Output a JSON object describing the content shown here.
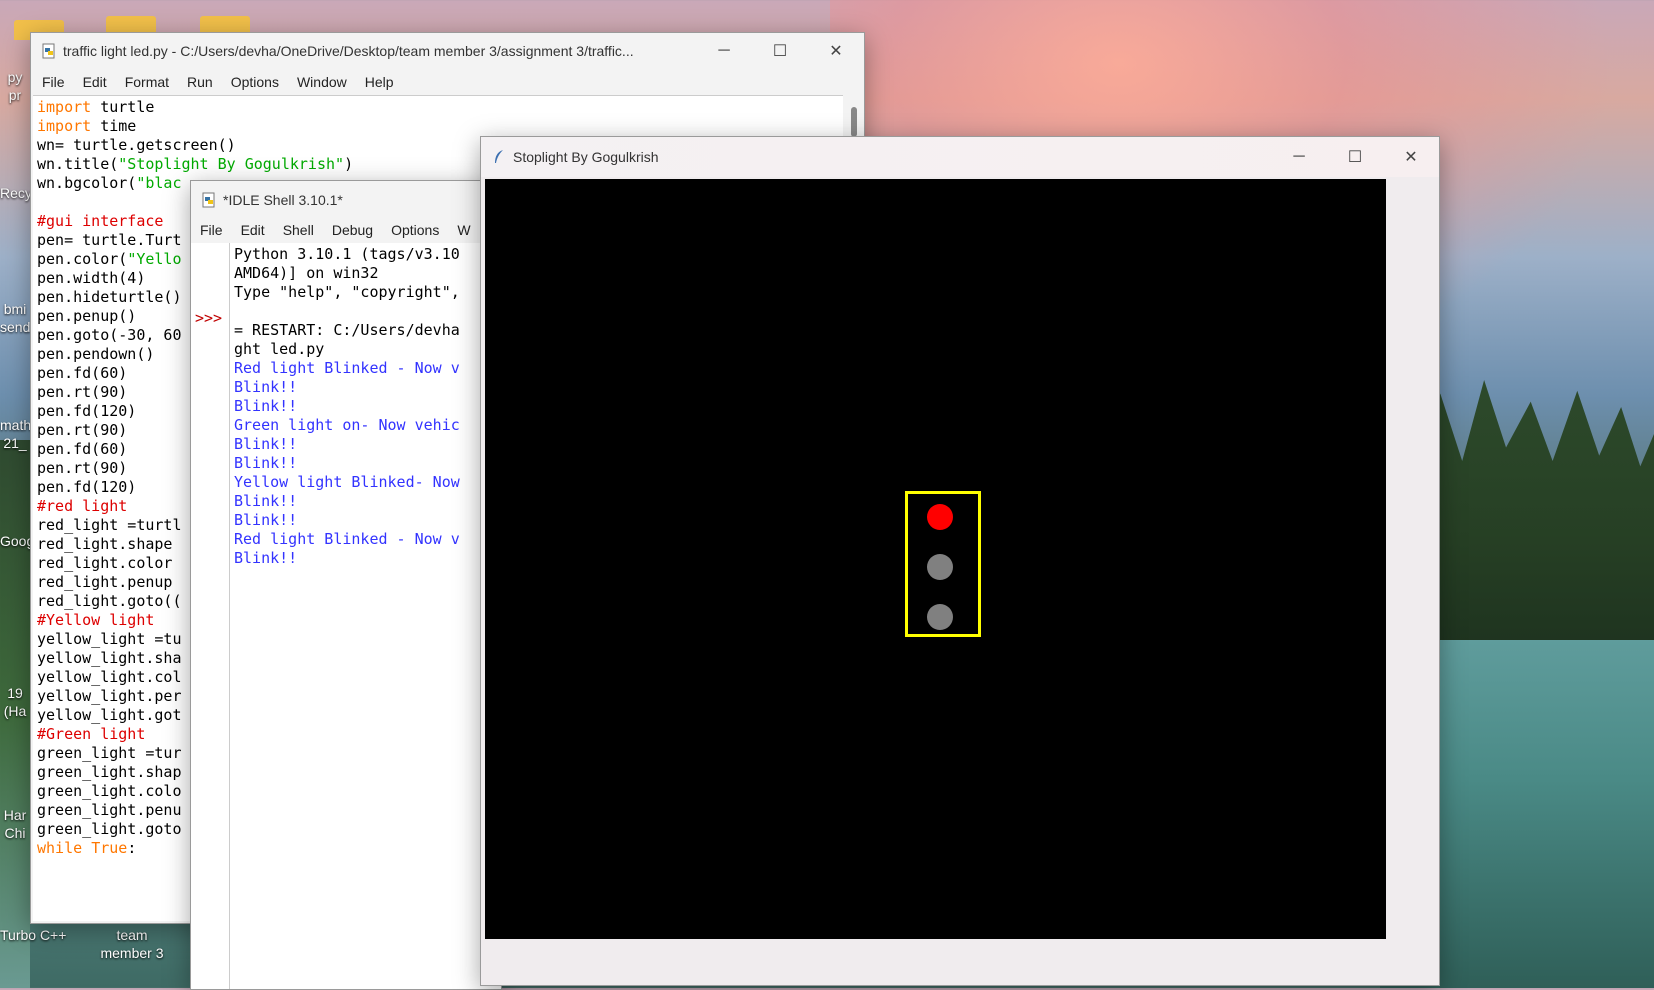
{
  "desktop": {
    "icons": [
      {
        "label": "py pr"
      },
      {
        "label": "Recy"
      },
      {
        "label": "bmi send"
      },
      {
        "label": "math 21_"
      },
      {
        "label": "Goog"
      },
      {
        "label": "19 (Ha"
      },
      {
        "label": "Har Chi"
      },
      {
        "label": "Turbo C++"
      },
      {
        "label": "team member 3"
      }
    ]
  },
  "editor": {
    "title": "traffic light led.py - C:/Users/devha/OneDrive/Desktop/team member 3/assignment 3/traffic...",
    "menu": [
      "File",
      "Edit",
      "Format",
      "Run",
      "Options",
      "Window",
      "Help"
    ],
    "lines": [
      [
        {
          "t": "import",
          "c": "kw"
        },
        {
          "t": " turtle",
          "c": "blk"
        }
      ],
      [
        {
          "t": "import",
          "c": "kw"
        },
        {
          "t": " time",
          "c": "blk"
        }
      ],
      [
        {
          "t": "wn= turtle.getscreen()",
          "c": "blk"
        }
      ],
      [
        {
          "t": "wn.title(",
          "c": "blk"
        },
        {
          "t": "\"Stoplight By Gogulkrish\"",
          "c": "str"
        },
        {
          "t": ")",
          "c": "blk"
        }
      ],
      [
        {
          "t": "wn.bgcolor(",
          "c": "blk"
        },
        {
          "t": "\"blac",
          "c": "str"
        }
      ],
      [
        {
          "t": "",
          "c": "blk"
        }
      ],
      [
        {
          "t": "#gui interface",
          "c": "cm"
        }
      ],
      [
        {
          "t": "pen= turtle.Turt",
          "c": "blk"
        }
      ],
      [
        {
          "t": "pen.color(",
          "c": "blk"
        },
        {
          "t": "\"Yello",
          "c": "str"
        }
      ],
      [
        {
          "t": "pen.width(4)",
          "c": "blk"
        }
      ],
      [
        {
          "t": "pen.hideturtle()",
          "c": "blk"
        }
      ],
      [
        {
          "t": "pen.penup()",
          "c": "blk"
        }
      ],
      [
        {
          "t": "pen.goto(-30, 60",
          "c": "blk"
        }
      ],
      [
        {
          "t": "pen.pendown()",
          "c": "blk"
        }
      ],
      [
        {
          "t": "pen.fd(60)",
          "c": "blk"
        }
      ],
      [
        {
          "t": "pen.rt(90)",
          "c": "blk"
        }
      ],
      [
        {
          "t": "pen.fd(120)",
          "c": "blk"
        }
      ],
      [
        {
          "t": "pen.rt(90)",
          "c": "blk"
        }
      ],
      [
        {
          "t": "pen.fd(60)",
          "c": "blk"
        }
      ],
      [
        {
          "t": "pen.rt(90)",
          "c": "blk"
        }
      ],
      [
        {
          "t": "pen.fd(120)",
          "c": "blk"
        }
      ],
      [
        {
          "t": "#red light",
          "c": "cm"
        }
      ],
      [
        {
          "t": "red_light =turtl",
          "c": "blk"
        }
      ],
      [
        {
          "t": "red_light.shape",
          "c": "blk"
        }
      ],
      [
        {
          "t": "red_light.color",
          "c": "blk"
        }
      ],
      [
        {
          "t": "red_light.penup",
          "c": "blk"
        }
      ],
      [
        {
          "t": "red_light.goto((",
          "c": "blk"
        }
      ],
      [
        {
          "t": "#Yellow light",
          "c": "cm"
        }
      ],
      [
        {
          "t": "yellow_light =tu",
          "c": "blk"
        }
      ],
      [
        {
          "t": "yellow_light.sha",
          "c": "blk"
        }
      ],
      [
        {
          "t": "yellow_light.col",
          "c": "blk"
        }
      ],
      [
        {
          "t": "yellow_light.per",
          "c": "blk"
        }
      ],
      [
        {
          "t": "yellow_light.got",
          "c": "blk"
        }
      ],
      [
        {
          "t": "#Green light",
          "c": "cm"
        }
      ],
      [
        {
          "t": "green_light =tur",
          "c": "blk"
        }
      ],
      [
        {
          "t": "green_light.shap",
          "c": "blk"
        }
      ],
      [
        {
          "t": "green_light.colo",
          "c": "blk"
        }
      ],
      [
        {
          "t": "green_light.penu",
          "c": "blk"
        }
      ],
      [
        {
          "t": "green_light.goto",
          "c": "blk"
        }
      ],
      [
        {
          "t": "while",
          "c": "kw"
        },
        {
          "t": " ",
          "c": "blk"
        },
        {
          "t": "True",
          "c": "kw"
        },
        {
          "t": ":",
          "c": "blk"
        }
      ]
    ]
  },
  "shell": {
    "title": "*IDLE Shell 3.10.1*",
    "menu": [
      "File",
      "Edit",
      "Shell",
      "Debug",
      "Options",
      "W"
    ],
    "prompt": ">>>",
    "lines": [
      {
        "t": "Python 3.10.1 (tags/v3.10",
        "c": "blk"
      },
      {
        "t": "AMD64)] on win32",
        "c": "blk"
      },
      {
        "t": "Type \"help\", \"copyright\",",
        "c": "blk"
      },
      {
        "t": "",
        "c": "blk"
      },
      {
        "t": "= RESTART: C:/Users/devha",
        "c": "blk"
      },
      {
        "t": "ght led.py",
        "c": "blk"
      },
      {
        "t": "Red light Blinked - Now v",
        "c": "out"
      },
      {
        "t": "Blink!!",
        "c": "out"
      },
      {
        "t": "Blink!!",
        "c": "out"
      },
      {
        "t": "Green light on- Now vehic",
        "c": "out"
      },
      {
        "t": "Blink!!",
        "c": "out"
      },
      {
        "t": "Blink!!",
        "c": "out"
      },
      {
        "t": "Yellow light Blinked- Now",
        "c": "out"
      },
      {
        "t": "Blink!!",
        "c": "out"
      },
      {
        "t": "Blink!!",
        "c": "out"
      },
      {
        "t": "Red light Blinked - Now v",
        "c": "out"
      },
      {
        "t": "Blink!!",
        "c": "out"
      }
    ]
  },
  "turtle_window": {
    "title": "Stoplight By Gogulkrish",
    "controls": {
      "minimize": "─",
      "maximize": "☐",
      "close": "✕"
    },
    "lamps": [
      {
        "name": "red-lamp",
        "color": "#ff0000"
      },
      {
        "name": "yellow-lamp",
        "color": "#808080"
      },
      {
        "name": "green-lamp",
        "color": "#808080"
      }
    ],
    "frame_color": "#ffff00"
  }
}
